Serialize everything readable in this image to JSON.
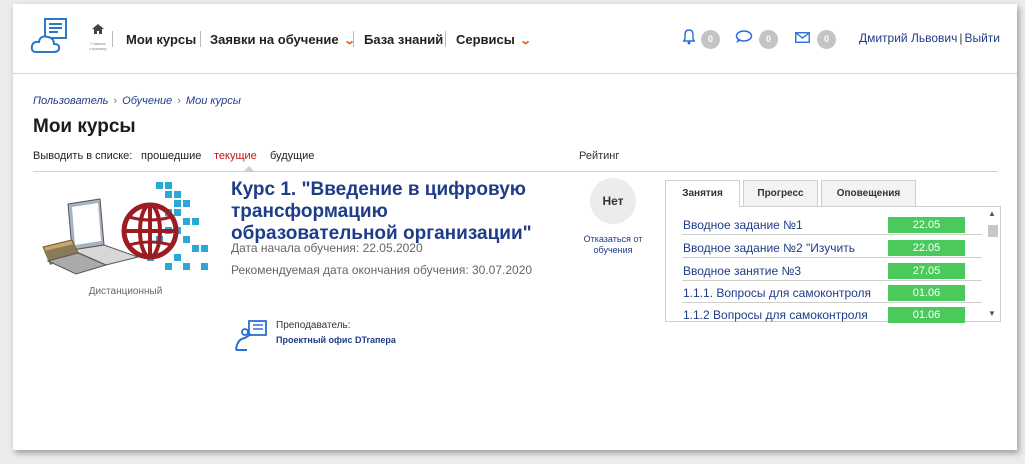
{
  "header": {
    "home_caption": "Главная страница",
    "nav": [
      {
        "label": "Мои курсы"
      },
      {
        "label": "Заявки на обучение"
      },
      {
        "label": "База знаний"
      },
      {
        "label": "Сервисы"
      }
    ],
    "counters": {
      "notifications": "0",
      "messages": "0",
      "mail": "0"
    },
    "user_name": "Дмитрий Львович",
    "logout": "Выйти"
  },
  "breadcrumb": [
    "Пользователь",
    "Обучение",
    "Мои курсы"
  ],
  "page_title": "Мои курсы",
  "filter": {
    "label": "Выводить в списке:",
    "options": [
      "прошедшие",
      "текущие",
      "будущие"
    ],
    "active": "текущие",
    "rating_header": "Рейтинг"
  },
  "course": {
    "title": "Курс 1. \"Введение в цифровую трансформацию образовательной организации\"",
    "start_date": "Дата начала обучения: 22.05.2020",
    "end_date": "Рекомендуемая дата окончания обучения: 30.07.2020",
    "mode": "Дистанционный",
    "teacher_label": "Преподаватель:",
    "teacher_name": "Проектный офис DTrапера",
    "rating": "Нет",
    "refuse": "Отказаться от обучения"
  },
  "tabs": [
    "Занятия",
    "Прогресс",
    "Оповещения"
  ],
  "active_tab": "Занятия",
  "lessons": [
    {
      "name": "Вводное задание №1",
      "date": "22.05"
    },
    {
      "name": "Вводное задание №2 \"Изучить",
      "date": "22.05"
    },
    {
      "name": "Вводное занятие №3",
      "date": "27.05"
    },
    {
      "name": "1.1.1. Вопросы для самоконтроля",
      "date": "01.06"
    },
    {
      "name": "1.1.2 Вопросы для самоконтроля",
      "date": "01.06"
    }
  ],
  "colors": {
    "link": "#1f3c88",
    "accent_orange": "#e06010",
    "active_filter": "#c01818",
    "date_badge": "#4cc95d"
  },
  "icons": [
    "cloud-logo-icon",
    "home-icon",
    "bell-icon",
    "chat-icon",
    "mail-icon",
    "teacher-icon"
  ]
}
